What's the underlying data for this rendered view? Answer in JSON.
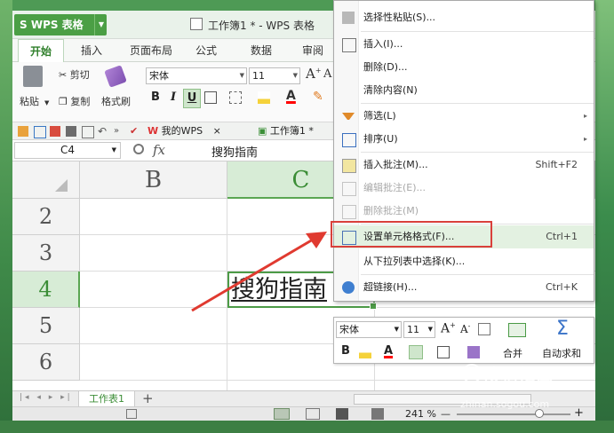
{
  "app": {
    "name": "WPS 表格",
    "window_title": "工作簿1 * - WPS 表格"
  },
  "ribbon_tabs": [
    "开始",
    "插入",
    "页面布局",
    "公式",
    "数据",
    "审阅"
  ],
  "ribbon": {
    "paste": "粘贴",
    "cut": "剪切",
    "copy": "复制",
    "format_painter": "格式刷",
    "font_name": "宋体",
    "font_size": "11",
    "bold": "B",
    "italic": "I",
    "underline": "U",
    "grow_font": "A",
    "shrink_font": "A"
  },
  "doc_tabs": {
    "mywps": "我的WPS",
    "close": "×",
    "workbook": "工作簿1 *"
  },
  "formula_bar": {
    "name_box": "C4",
    "fx": "fx",
    "value": "搜狗指南"
  },
  "grid": {
    "columns": [
      "B",
      "C"
    ],
    "rows": [
      "2",
      "3",
      "4",
      "5",
      "6"
    ],
    "cell_C4": "搜狗指南"
  },
  "context_menu": {
    "items": [
      {
        "label": "选择性粘贴(S)...",
        "icon": "paste-special-icon"
      },
      {
        "label": "插入(I)...",
        "icon": "insert-icon"
      },
      {
        "label": "删除(D)..."
      },
      {
        "label": "清除内容(N)"
      },
      {
        "label": "筛选(L)",
        "icon": "filter-icon",
        "submenu": "▸"
      },
      {
        "label": "排序(U)",
        "icon": "sort-icon",
        "submenu": "▸"
      },
      {
        "label": "插入批注(M)...",
        "icon": "insert-comment-icon",
        "shortcut": "Shift+F2"
      },
      {
        "label": "编辑批注(E)...",
        "icon": "edit-comment-icon",
        "disabled": true
      },
      {
        "label": "删除批注(M)",
        "icon": "delete-comment-icon",
        "disabled": true
      },
      {
        "label": "设置单元格格式(F)...",
        "icon": "format-cells-icon",
        "shortcut": "Ctrl+1",
        "highlighted": true
      },
      {
        "label": "从下拉列表中选择(K)..."
      },
      {
        "label": "超链接(H)...",
        "icon": "hyperlink-icon",
        "shortcut": "Ctrl+K"
      }
    ]
  },
  "mini_toolbar": {
    "font_name": "宋体",
    "font_size": "11",
    "bold": "B",
    "merge": "合并",
    "autosum": "自动求和",
    "autosum_symbol": "Σ"
  },
  "sheet_tabs": {
    "active": "工作表1",
    "add": "+"
  },
  "status_bar": {
    "zoom": "241 %",
    "zoom_minus": "—",
    "zoom_plus": "+"
  },
  "watermark": {
    "text": "搜狗指南",
    "url": "zhinan.sogou.com"
  },
  "colors": {
    "accent": "#4b9f45",
    "highlight_box": "#d9403b",
    "arrow": "#e03a30"
  }
}
